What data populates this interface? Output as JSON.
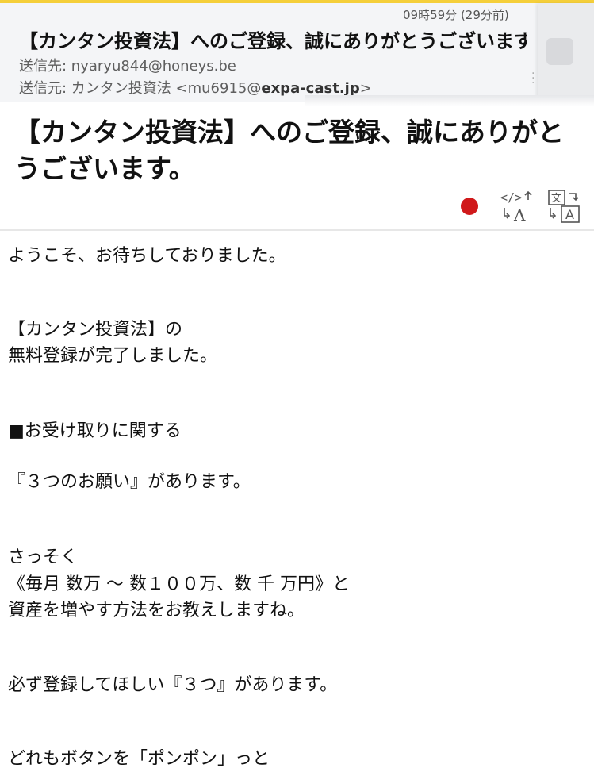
{
  "header": {
    "time": "09時59分 (29分前)",
    "subject": "【カンタン投資法】へのご登録、誠にありがとうございます",
    "to_label": "送信先: ",
    "to_value": "nyaryu844@honeys.be",
    "from_label": "送信元: ",
    "from_name": "カンタン投資法 <mu6915@",
    "from_domain": "expa-cast.jp",
    "from_end": ">"
  },
  "title": "【カンタン投資法】へのご登録、誠にありがとうございます。",
  "toolbar": {
    "icons": [
      "red-dot-icon",
      "code-translate-icon",
      "translate-icon"
    ]
  },
  "body": [
    "ようこそ、お待ちしておりました。",
    "【カンタン投資法】の",
    "無料登録が完了しました。",
    "■お受け取りに関する",
    "『３つのお願い』があります。",
    "さっそく",
    "《毎月 数万 〜 数１００万、数 千 万円》と",
    "資産を増やす方法をお教えしますね。",
    "必ず登録してほしい『３つ』があります。",
    "どれもボタンを「ポンポン」っと"
  ],
  "colors": {
    "accent_bar": "#f5cf3a",
    "header_bg": "#f4f5f7",
    "red_dot": "#d0191b"
  }
}
